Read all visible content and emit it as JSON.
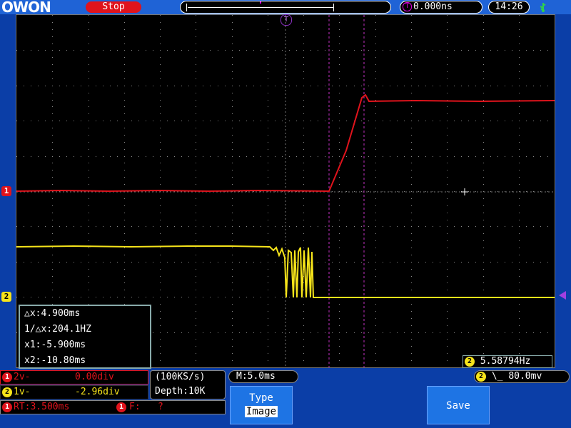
{
  "header": {
    "logo_text": "OWON",
    "run_state": "Stop",
    "trigger_position": "0.000ns",
    "trigger_marker": "T",
    "clock": "14:26"
  },
  "channels": {
    "ch1": {
      "label": "1",
      "color": "#e0131c"
    },
    "ch2": {
      "label": "2",
      "color": "#f6e41a"
    }
  },
  "cursor_measurements": {
    "delta_x": "△x:4.900ms",
    "inverse_delta_x": "1/△x:204.1HZ",
    "x1": "x1:-5.900ms",
    "x2": "x2:-10.80ms"
  },
  "frequency_readout": {
    "channel": "2",
    "value": "5.58794Hz"
  },
  "status": {
    "ch2_volts": "2v-",
    "ch2_position": "0.00div",
    "ch1_volts": "1v-",
    "ch1_position": "-2.96div",
    "sample_rate": "(100KS/s)",
    "depth": "Depth:10K",
    "rise_time": "RT:3.500ms",
    "fall_time_label": "F:",
    "fall_time_value": "?",
    "timebase": "M:5.0ms",
    "trigger_channel": "2",
    "trigger_level": "80.0mv"
  },
  "menu": {
    "type_label": "Type",
    "type_value": "Image",
    "save_label": "Save"
  }
}
